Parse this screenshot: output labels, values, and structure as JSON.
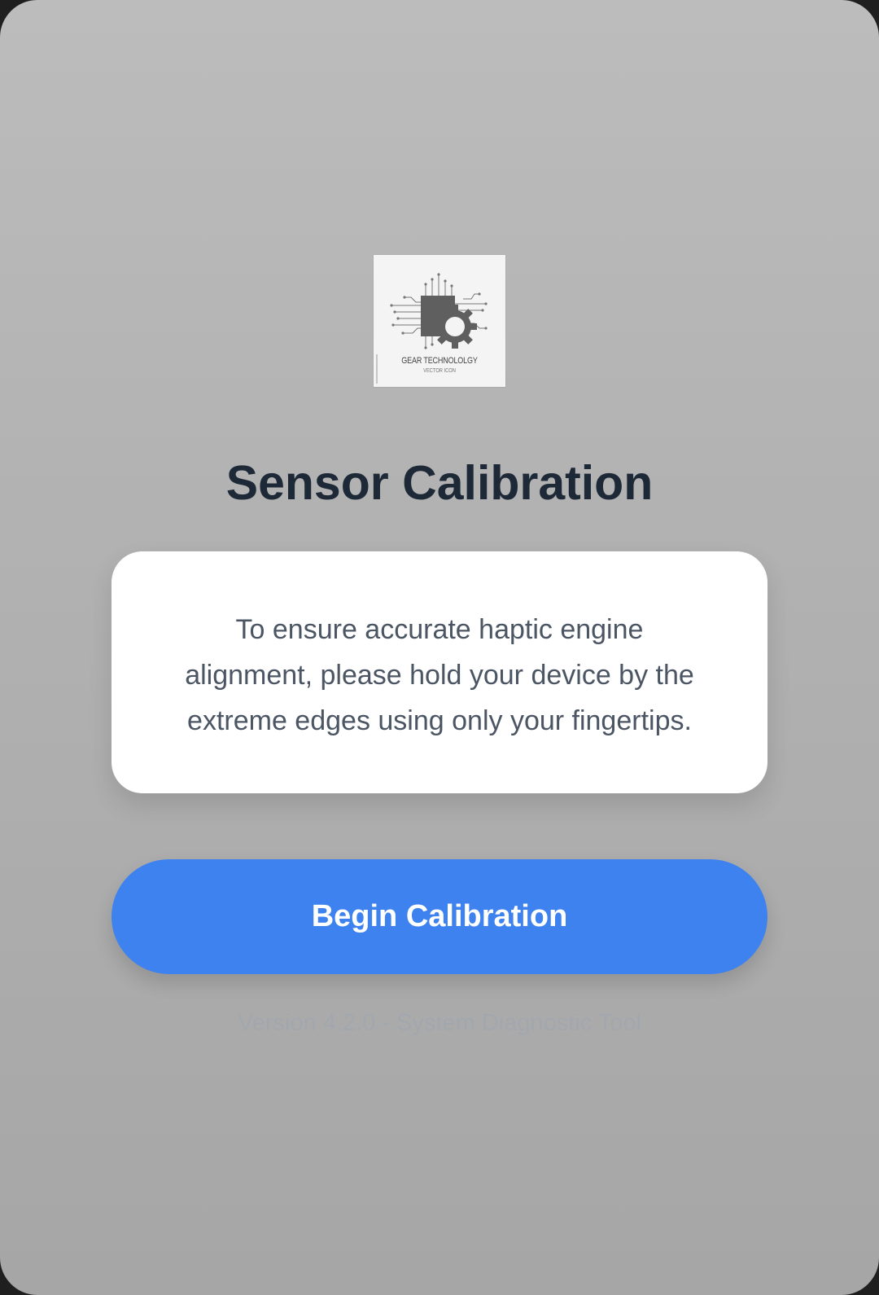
{
  "app": {
    "logo": {
      "icon": "gear-chip-icon",
      "caption_main": "GEAR TECHNOLOLGY",
      "caption_sub": "VECTOR ICON"
    },
    "title": "Sensor Calibration",
    "instructions": "To ensure accurate haptic engine alignment, please hold your device by the extreme edges using only your fingertips.",
    "primary_button_label": "Begin Calibration",
    "footer_version": "Version 4.2.0 - System Diagnostic Tool"
  },
  "colors": {
    "accent": "#3e82f0",
    "title": "#1e2938",
    "body_text": "#4b5563",
    "card": "#ffffff"
  }
}
